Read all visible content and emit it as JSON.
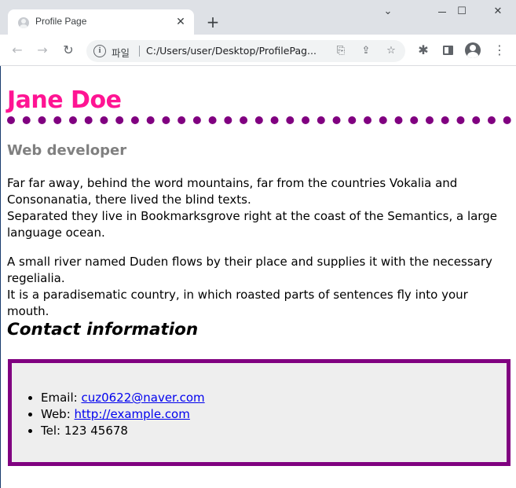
{
  "browser": {
    "tab_title": "Profile Page",
    "tab_close": "✕",
    "new_tab": "+",
    "window": {
      "minimize": "⌄",
      "maximize": "☐",
      "close": "✕"
    },
    "omnibox": {
      "scheme_label": "파일",
      "url": "C:/Users/user/Desktop/ProfilePag..."
    },
    "icons": {
      "back": "←",
      "forward": "→",
      "reload": "↻",
      "translate": "⎘",
      "share": "⇪",
      "bookmark": "☆",
      "extensions": "✱",
      "menu": "⋮"
    }
  },
  "profile": {
    "name": "Jane Doe",
    "role": "Web developer",
    "paragraphs": [
      {
        "line1": "Far far away, behind the word mountains, far from the countries Vokalia and Consonanatia, there lived the blind texts.",
        "line2": "Separated they live in Bookmarksgrove right at the coast of the Semantics, a large language ocean."
      },
      {
        "line1": "A small river named Duden flows by their place and supplies it with the necessary regelialia.",
        "line2": "It is a paradisematic country, in which roasted parts of sentences fly into your mouth."
      }
    ],
    "contact": {
      "title": "Contact information",
      "email_label": "Email: ",
      "email": "cuz0622@naver.com",
      "web_label": "Web: ",
      "web": "http://example.com",
      "tel_label": "Tel: ",
      "tel": "123 45678"
    }
  },
  "colors": {
    "name": "#ff1493",
    "role": "#808080",
    "accent_border": "#800080",
    "contact_bg": "#eeeeee",
    "link": "#0000ee"
  }
}
